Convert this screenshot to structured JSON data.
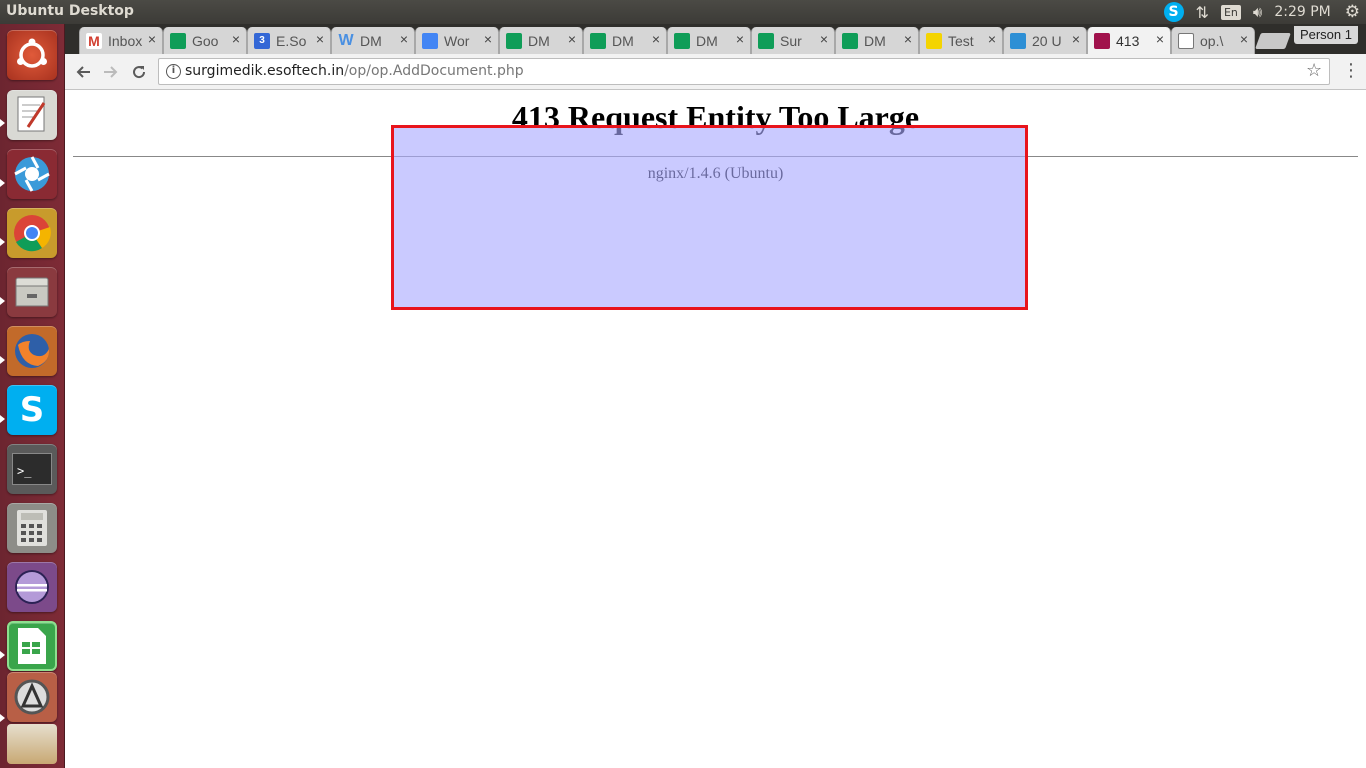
{
  "top_panel": {
    "title": "Ubuntu Desktop",
    "lang": "En",
    "clock": "2:29 PM"
  },
  "browser": {
    "tabs": [
      {
        "label": "Inbox",
        "icon": "gmail-icon",
        "color": "#ffffff"
      },
      {
        "label": "Goo",
        "icon": "sheets-icon",
        "color": "#0f9d58"
      },
      {
        "label": "E.So",
        "icon": "calendar-icon",
        "color": "#3367d6"
      },
      {
        "label": "DM",
        "icon": "wordpress-icon",
        "color": "#4a90e2"
      },
      {
        "label": "Wor",
        "icon": "docs-icon",
        "color": "#4285f4"
      },
      {
        "label": "DM",
        "icon": "sheets-icon",
        "color": "#0f9d58"
      },
      {
        "label": "DM",
        "icon": "sheets-icon",
        "color": "#0f9d58"
      },
      {
        "label": "DM",
        "icon": "sheets-icon",
        "color": "#0f9d58"
      },
      {
        "label": "Sur",
        "icon": "sheets-icon",
        "color": "#0f9d58"
      },
      {
        "label": "DM",
        "icon": "sheets-icon",
        "color": "#0f9d58"
      },
      {
        "label": "Test",
        "icon": "crash-test-icon",
        "color": "#f4d400"
      },
      {
        "label": "20 U",
        "icon": "diamond-icon",
        "color": "#2d8fd5"
      },
      {
        "label": "413",
        "icon": "server-icon",
        "color": "#a1124c"
      },
      {
        "label": "op.\\",
        "icon": "page-icon",
        "color": "#ffffff"
      }
    ],
    "profile": "Person 1",
    "url_host": "surgimedik.esoftech.in",
    "url_path": "/op/op.AddDocument.php"
  },
  "page": {
    "heading": "413 Request Entity Too Large",
    "server": "nginx/1.4.6 (Ubuntu)"
  },
  "launcher": [
    "ubuntu-dash-icon",
    "text-editor-icon",
    "shutter-icon",
    "chrome-icon",
    "file-manager-icon",
    "firefox-icon",
    "skype-icon",
    "terminal-icon",
    "calculator-icon",
    "eclipse-icon",
    "libreoffice-calc-icon",
    "software-updater-icon"
  ]
}
